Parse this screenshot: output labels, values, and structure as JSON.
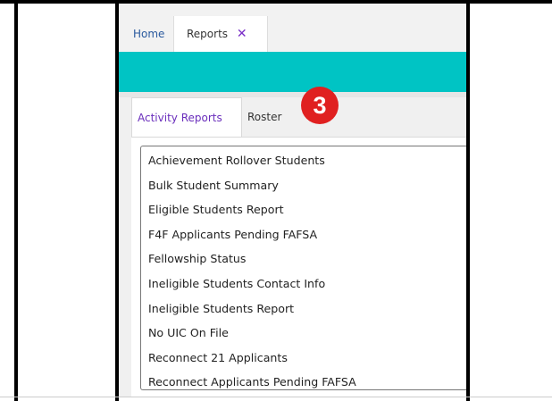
{
  "top_tabs": {
    "home_label": "Home",
    "reports_label": "Reports",
    "close_icon": "✕"
  },
  "colors": {
    "teal_bar": "#00c4c4",
    "active_subtab_text": "#6a2ebc",
    "badge": "#e02020"
  },
  "sub_tabs": {
    "activity_label": "Activity Reports",
    "roster_label": "Roster"
  },
  "badge": {
    "number": "3"
  },
  "report_list": [
    "Achievement Rollover Students",
    "Bulk Student Summary",
    "Eligible Students Report",
    "F4F Applicants Pending FAFSA",
    "Fellowship Status",
    "Ineligible Students Contact Info",
    "Ineligible Students Report",
    "No UIC On File",
    "Reconnect 21 Applicants",
    "Reconnect Applicants Pending FAFSA"
  ]
}
